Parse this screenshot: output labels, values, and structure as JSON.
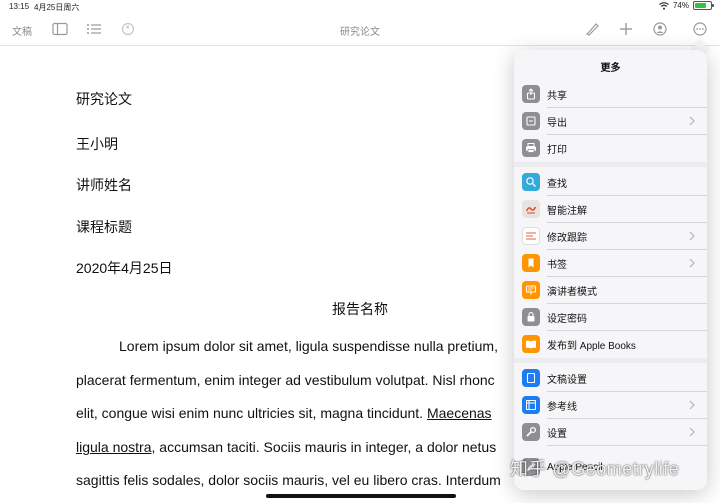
{
  "status_bar": {
    "time": "13:15",
    "date": "4月25日周六",
    "battery": "74%",
    "battery_level": 0.74
  },
  "toolbar": {
    "documents_label": "文稿",
    "title": "研究论文"
  },
  "document": {
    "lines": [
      "研究论文",
      "王小明",
      "讲师姓名",
      "课程标题",
      "2020年4月25日"
    ],
    "report_title": "报告名称",
    "paragraph": {
      "line1": "Lorem ipsum dolor sit amet, ligula suspendisse nulla pretium,",
      "line2": "placerat fermentum, enim integer ad vestibulum volutpat. Nisl rhonc",
      "line3_a": "elit, congue wisi enim nunc ultricies sit, magna tincidunt. ",
      "line3_b": "Maecenas",
      "line4_a": "ligula nostra",
      "line4_b": ", accumsan taciti. Sociis mauris in integer, a dolor netus",
      "line5": "sagittis felis sodales, dolor sociis mauris, vel eu libero cras. Interdum"
    }
  },
  "more_menu": {
    "title": "更多",
    "items": [
      {
        "label": "共享",
        "icon": "share-icon",
        "color": "#8e8e93"
      },
      {
        "label": "导出",
        "icon": "export-icon",
        "color": "#8e8e93"
      },
      {
        "label": "打印",
        "icon": "printer-icon",
        "color": "#8e8e93"
      },
      {
        "label": "查找",
        "icon": "search-icon",
        "color": "#34aadc"
      },
      {
        "label": "智能注解",
        "icon": "smart-annotation-icon",
        "color": "#e8e3de"
      },
      {
        "label": "修改跟踪",
        "icon": "track-changes-icon",
        "color": "#ffffff"
      },
      {
        "label": "书签",
        "icon": "bookmark-icon",
        "color": "#ff9500"
      },
      {
        "label": "演讲者模式",
        "icon": "presenter-icon",
        "color": "#ff9500"
      },
      {
        "label": "设定密码",
        "icon": "lock-icon",
        "color": "#8e8e93"
      },
      {
        "label": "发布到 Apple Books",
        "icon": "books-icon",
        "color": "#ff9500"
      },
      {
        "label": "文稿设置",
        "icon": "document-setup-icon",
        "color": "#1c7cf4"
      },
      {
        "label": "参考线",
        "icon": "guides-icon",
        "color": "#1c7cf4"
      },
      {
        "label": "设置",
        "icon": "wrench-icon",
        "color": "#8e8e93"
      },
      {
        "label": "Apple Pencil",
        "icon": "pencil-icon",
        "color": "#8e8e93"
      }
    ]
  },
  "watermark": "知乎 @Geometrylife"
}
